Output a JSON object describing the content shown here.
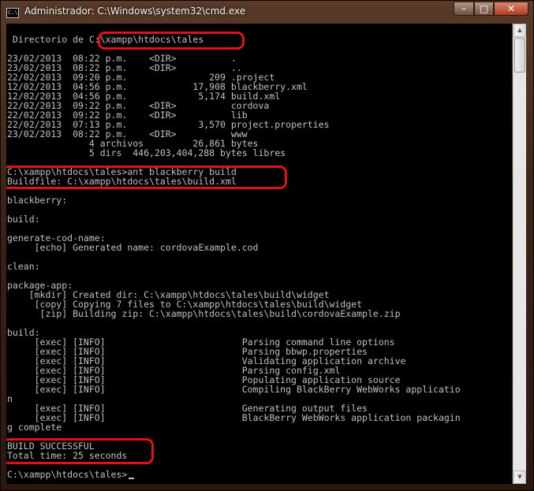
{
  "window": {
    "title": "Administrador: C:\\Windows\\system32\\cmd.exe",
    "icon_label": "C:\\",
    "controls": {
      "minimize": "–",
      "maximize": "□",
      "close": "✕"
    }
  },
  "console": {
    "lines": [
      " Directorio de C:\\xampp\\htdocs\\tales",
      "",
      "23/02/2013  08:22 p.m.    <DIR>          .",
      "23/02/2013  08:22 p.m.    <DIR>          ..",
      "22/02/2013  09:20 p.m.               209 .project",
      "12/02/2013  04:56 p.m.            17,908 blackberry.xml",
      "12/02/2013  04:56 p.m.             5,174 build.xml",
      "22/02/2013  09:22 p.m.    <DIR>          cordova",
      "22/02/2013  09:22 p.m.    <DIR>          lib",
      "22/02/2013  07:13 p.m.             3,570 project.properties",
      "23/02/2013  08:22 p.m.    <DIR>          www",
      "               4 archivos         26,861 bytes",
      "               5 dirs  446,203,404,288 bytes libres",
      "",
      "C:\\xampp\\htdocs\\tales>ant blackberry build",
      "Buildfile: C:\\xampp\\htdocs\\tales\\build.xml",
      "",
      "blackberry:",
      "",
      "build:",
      "",
      "generate-cod-name:",
      "     [echo] Generated name: cordovaExample.cod",
      "",
      "clean:",
      "",
      "package-app:",
      "    [mkdir] Created dir: C:\\xampp\\htdocs\\tales\\build\\widget",
      "     [copy] Copying 7 files to C:\\xampp\\htdocs\\tales\\build\\widget",
      "      [zip] Building zip: C:\\xampp\\htdocs\\tales\\build\\cordovaExample.zip",
      "",
      "build:",
      "     [exec] [INFO]                         Parsing command line options",
      "     [exec] [INFO]                         Parsing bbwp.properties",
      "     [exec] [INFO]                         Validating application archive",
      "     [exec] [INFO]                         Parsing config.xml",
      "     [exec] [INFO]                         Populating application source",
      "     [exec] [INFO]                         Compiling BlackBerry WebWorks applicatio",
      "n",
      "     [exec] [INFO]                         Generating output files",
      "     [exec] [INFO]                         BlackBerry WebWorks application packagin",
      "g complete",
      "",
      "BUILD SUCCESSFUL",
      "Total time: 25 seconds",
      "",
      "C:\\xampp\\htdocs\\tales>"
    ]
  },
  "scrollbar": {
    "up": "▲",
    "down": "▼"
  },
  "colors": {
    "console_text": "#c0c0c0",
    "console_bg": "#000000",
    "highlight": "#e3101a"
  }
}
